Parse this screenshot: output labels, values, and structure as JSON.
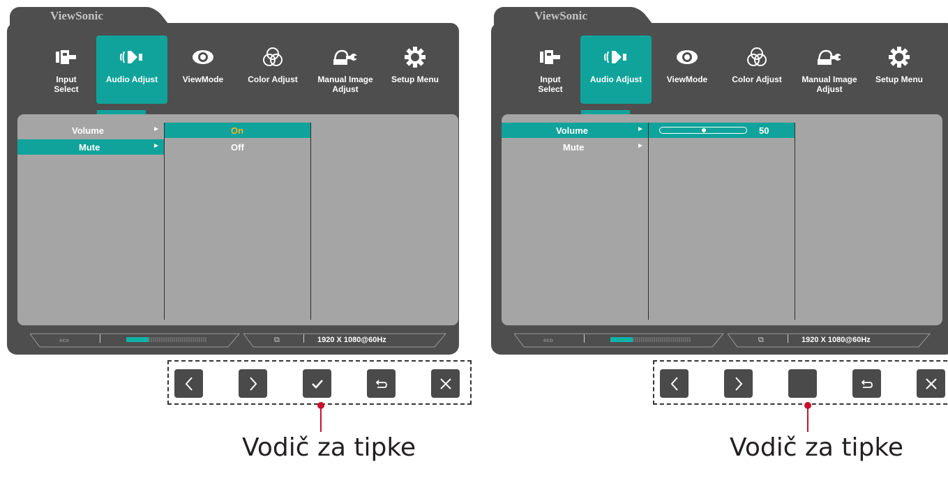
{
  "brand": "ViewSonic",
  "tabs": [
    {
      "label": "Input\nSelect",
      "icon": "input-select-icon"
    },
    {
      "label": "Audio Adjust",
      "icon": "speaker-icon"
    },
    {
      "label": "ViewMode",
      "icon": "eye-icon"
    },
    {
      "label": "Color Adjust",
      "icon": "color-circles-icon"
    },
    {
      "label": "Manual Image\nAdjust",
      "icon": "wrench-hand-icon"
    },
    {
      "label": "Setup Menu",
      "icon": "gear-icon"
    }
  ],
  "active_tab": "Audio Adjust",
  "accent_color": "#0fa39b",
  "highlight_value_color": "#f5b323",
  "left_screen": {
    "menu": [
      {
        "label": "Volume",
        "selected": false
      },
      {
        "label": "Mute",
        "selected": true
      }
    ],
    "submenu": [
      {
        "label": "On",
        "selected": true
      },
      {
        "label": "Off",
        "selected": false
      }
    ]
  },
  "right_screen": {
    "menu": [
      {
        "label": "Volume",
        "selected": true
      },
      {
        "label": "Mute",
        "selected": false
      }
    ],
    "volume_value": "50",
    "volume_level_fraction": 0.5
  },
  "status_bar": {
    "resolution": "1920 X 1080@60Hz",
    "eco_label": "eco",
    "level_fraction": 0.28
  },
  "key_guide": {
    "left_keys": [
      "chevron-left-icon",
      "chevron-right-icon",
      "check-icon",
      "return-icon",
      "close-icon"
    ],
    "right_keys": [
      "chevron-left-icon",
      "chevron-right-icon",
      "blank-key",
      "return-icon",
      "close-icon"
    ]
  },
  "caption": "Vodič za tipke"
}
